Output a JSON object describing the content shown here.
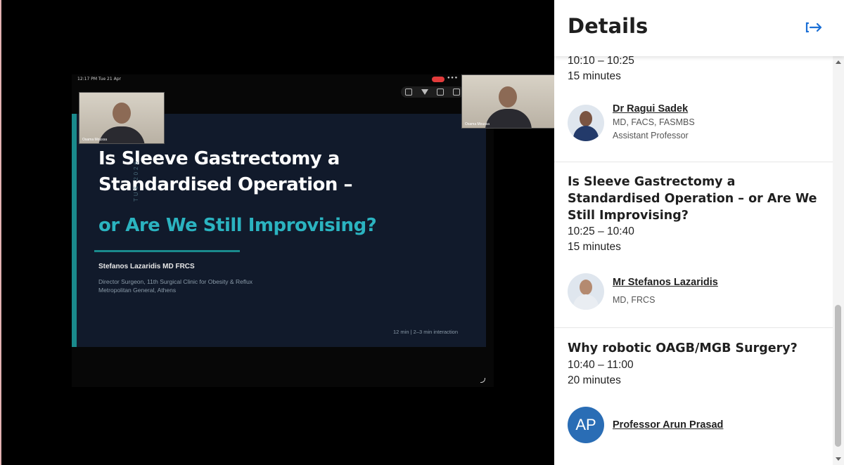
{
  "video": {
    "status_time": "12:17 PM   Tue 21 Apr",
    "slide": {
      "title_line1": "Is Sleeve Gastrectomy a",
      "title_line2": "Standardised Operation –",
      "subtitle": "or Are We Still Improvising?",
      "vertical_text": "TUS 2026",
      "author": "Stefanos Lazaridis  MD FRCS",
      "affiliation_line1": "Director Surgeon, 11th Surgical Clinic for Obesity & Reflux",
      "affiliation_line2": "Metropolitan General, Athens",
      "meta": "12 min  |  2–3 min interaction"
    },
    "camera_small_label": "Osama Moussa",
    "camera_large_label": "Osama Moussa"
  },
  "panel": {
    "title": "Details",
    "sessions": [
      {
        "time": "10:10 – 10:25",
        "duration": "15 minutes",
        "speaker": "Dr Ragui Sadek",
        "credentials": "MD, FACS, FASMBS",
        "role": "Assistant Professor"
      },
      {
        "title": "Is Sleeve Gastrectomy a Standardised Operation – or Are We Still Improvising?",
        "time": "10:25 – 10:40",
        "duration": "15 minutes",
        "speaker": "Mr Stefanos Lazaridis",
        "credentials": "MD, FRCS"
      },
      {
        "title": "Why robotic OAGB/MGB Surgery?",
        "time": "10:40 – 11:00",
        "duration": "20 minutes",
        "speaker": "Professor Arun Prasad",
        "initials": "AP"
      }
    ]
  },
  "colors": {
    "slide_bg": "#111a2b",
    "accent_teal": "#1a8a8c",
    "subtitle_cyan": "#2bb3c0",
    "avatar_blue": "#2a6db5",
    "collapse_icon": "#1a6fd6"
  },
  "icons": [
    "collapse-panel-icon",
    "scroll-up-icon",
    "scroll-down-icon"
  ]
}
